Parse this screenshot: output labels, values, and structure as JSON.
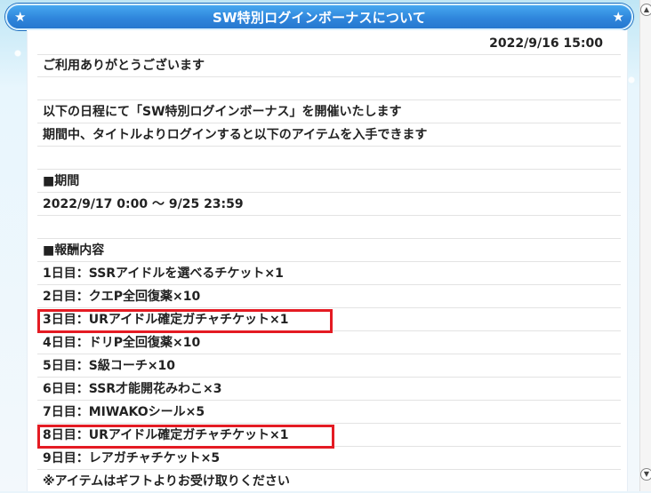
{
  "header": {
    "title": "SW特別ログインボーナスについて"
  },
  "notice": {
    "date": "2022/9/16 15:00",
    "greeting": "ご利用ありがとうございます",
    "line1": "以下の日程にて「SW特別ログインボーナス」を開催いたします",
    "line2": "期間中、タイトルよりログインすると以下のアイテムを入手できます",
    "period_heading": "■期間",
    "period_value": "2022/9/17 0:00 ～ 9/25 23:59",
    "rewards_heading": "■報酬内容",
    "rewards": [
      "1日目：SSRアイドルを選べるチケット×1",
      "2日目：クエP全回復薬×10",
      "3日目：URアイドル確定ガチャチケット×1",
      "4日目：ドリP全回復薬×10",
      "5日目：S級コーチ×10",
      "6日目：SSR才能開花みわこ×3",
      "7日目：MIWAKOシール×5",
      "8日目：URアイドル確定ガチャチケット×1",
      "9日目：レアガチャチケット×5"
    ],
    "footnote": "※アイテムはギフトよりお受け取りください"
  },
  "colors": {
    "header": "#2f86dc",
    "highlight": "#e41b23"
  }
}
